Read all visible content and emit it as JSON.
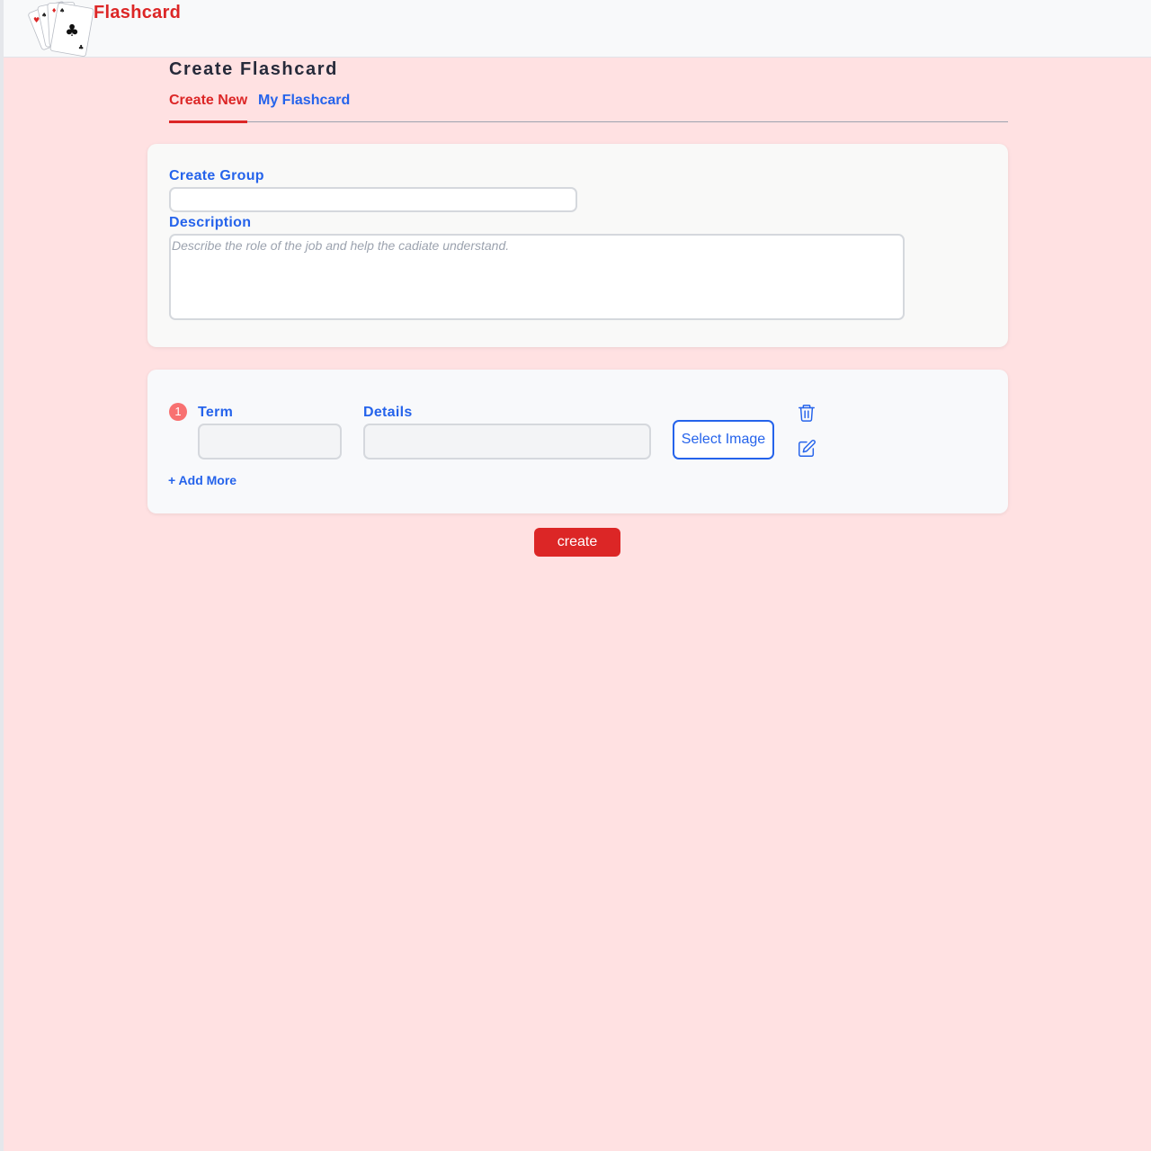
{
  "header": {
    "brand": "Flashcard"
  },
  "page": {
    "title": "Create Flashcard"
  },
  "tabs": [
    {
      "label": "Create New",
      "active": true
    },
    {
      "label": "My Flashcard",
      "active": false
    }
  ],
  "group_form": {
    "group_label": "Create Group",
    "group_value": "",
    "description_label": "Description",
    "description_value": "",
    "description_placeholder": "Describe the role of the job and help the cadiate understand."
  },
  "terms_form": {
    "rows": [
      {
        "number": "1",
        "term_label": "Term",
        "term_value": "",
        "details_label": "Details",
        "details_value": "",
        "select_image_label": "Select Image"
      }
    ],
    "add_more_label": "+ Add More"
  },
  "actions": {
    "create_label": "create"
  },
  "icons": {
    "logo": "playing-cards-logo-icon",
    "delete": "trash-icon",
    "edit": "pencil-edit-icon"
  },
  "colors": {
    "page_background": "#ffe1e2",
    "header_background": "#f8f9fa",
    "brand_red": "#dc2626",
    "link_blue": "#2563eb",
    "badge_red": "#f87171"
  }
}
